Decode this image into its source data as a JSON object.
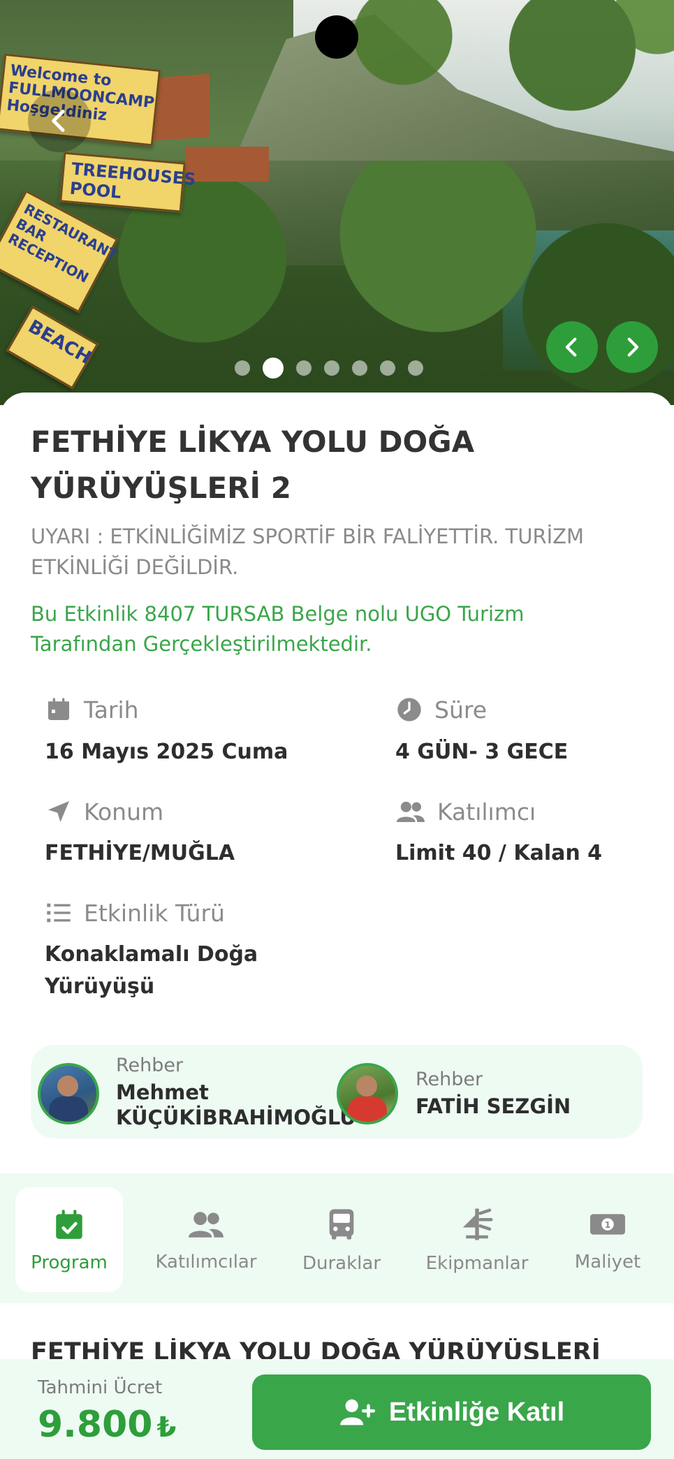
{
  "hero": {
    "sign_welcome": "Welcome to FULLMOONCAMP Hoşgeldiniz",
    "sign_treehouses": "TREEHOUSES POOL",
    "sign_restaurant": "RESTAURANT BAR RECEPTION",
    "sign_beach": "BEACH",
    "total_slides": 7,
    "active_slide": 2
  },
  "event": {
    "title": "FETHİYE LİKYA YOLU DOĞA YÜRÜYÜŞLERİ 2",
    "warning": "UYARI : ETKİNLİĞİMİZ SPORTİF BİR FALİYETTİR. TURİZM ETKİNLİĞİ DEĞİLDİR.",
    "tursab_note": "Bu Etkinlik 8407 TURSAB Belge nolu UGO Turizm Tarafından Gerçekleştirilmektedir."
  },
  "info": {
    "date_label": "Tarih",
    "date_value": "16 Mayıs 2025 Cuma",
    "duration_label": "Süre",
    "duration_value": "4 GÜN- 3 GECE",
    "location_label": "Konum",
    "location_value": "FETHİYE/MUĞLA",
    "participants_label": "Katılımcı",
    "participants_value": "Limit 40 / Kalan 4",
    "type_label": "Etkinlik Türü",
    "type_value": "Konaklamalı Doğa Yürüyüşü"
  },
  "guides": [
    {
      "role": "Rehber",
      "name": "Mehmet KÜÇÜKİBRAHİMOĞLU"
    },
    {
      "role": "Rehber",
      "name": "FATİH SEZGİN"
    }
  ],
  "tabs": [
    {
      "label": "Program",
      "icon": "calendar-check-icon",
      "active": true
    },
    {
      "label": "Katılımcılar",
      "icon": "users-icon",
      "active": false
    },
    {
      "label": "Duraklar",
      "icon": "bus-icon",
      "active": false
    },
    {
      "label": "Ekipmanlar",
      "icon": "equipment-icon",
      "active": false
    },
    {
      "label": "Maliyet",
      "icon": "money-icon",
      "active": false
    }
  ],
  "program": {
    "heading": "FETHİYE LİKYA YOLU DOĞA YÜRÜYÜŞLERİ"
  },
  "footer": {
    "price_label": "Tahmini Ücret",
    "price_value": "9.800",
    "currency": "₺",
    "join_label": "Etkinliğe Katıl"
  },
  "colors": {
    "accent": "#3aa64a",
    "accent_dark": "#2e9e3a",
    "panel_bg": "#eefbf3",
    "muted_text": "#8a8a8a"
  }
}
